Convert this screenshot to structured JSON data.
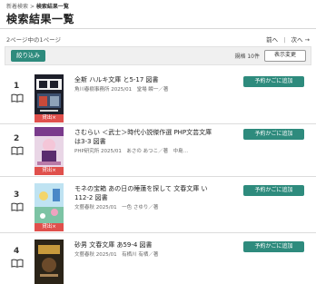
{
  "breadcrumb": {
    "items": [
      "新着検索",
      "検索結果一覧"
    ],
    "separator": ">"
  },
  "page_title": "検索結果一覧",
  "page_info": "2ページ中の1ページ",
  "pager": {
    "prev": "前へ",
    "separator": "|",
    "next": "次へ →"
  },
  "toolbar": {
    "filter_label": "絞り込み",
    "display_count": "規格 10件",
    "display_change_label": "表示変更"
  },
  "colors": {
    "accent": "#2e8b7d",
    "badge": "#e0504c"
  },
  "results": [
    {
      "num": "1",
      "title": "全斯 ハルキ文庫 と5-17 図書",
      "meta": "角川春樹事務所 2025/01　堂場 瞬一／著",
      "status": "貸出×",
      "reserve_label": "予約かごに追加",
      "cover_icon": "book-cover-dark"
    },
    {
      "num": "2",
      "title": "さむらい ＜武士＞時代小説傑作選 PHP文芸文庫 は3-3 図書",
      "meta": "PHP研究所 2025/01　あさの あつこ／著　中島…",
      "status": "貸出×",
      "reserve_label": "予約かごに追加",
      "cover_icon": "book-cover-purple"
    },
    {
      "num": "3",
      "title": "モネの宝箱 あの日の睡蓮を探して 文春文庫 い112-2 図書",
      "meta": "文藝春秋 2025/01　一色 さゆり／著",
      "status": "貸出×",
      "reserve_label": "予約かごに追加",
      "cover_icon": "book-cover-blue"
    },
    {
      "num": "4",
      "title": "砂男 文春文庫 あ59-4 図書",
      "meta": "文藝春秋 2025/01　有栖川 有栖／著",
      "status": "",
      "reserve_label": "予約かごに追加",
      "cover_icon": "book-cover-dark"
    }
  ]
}
